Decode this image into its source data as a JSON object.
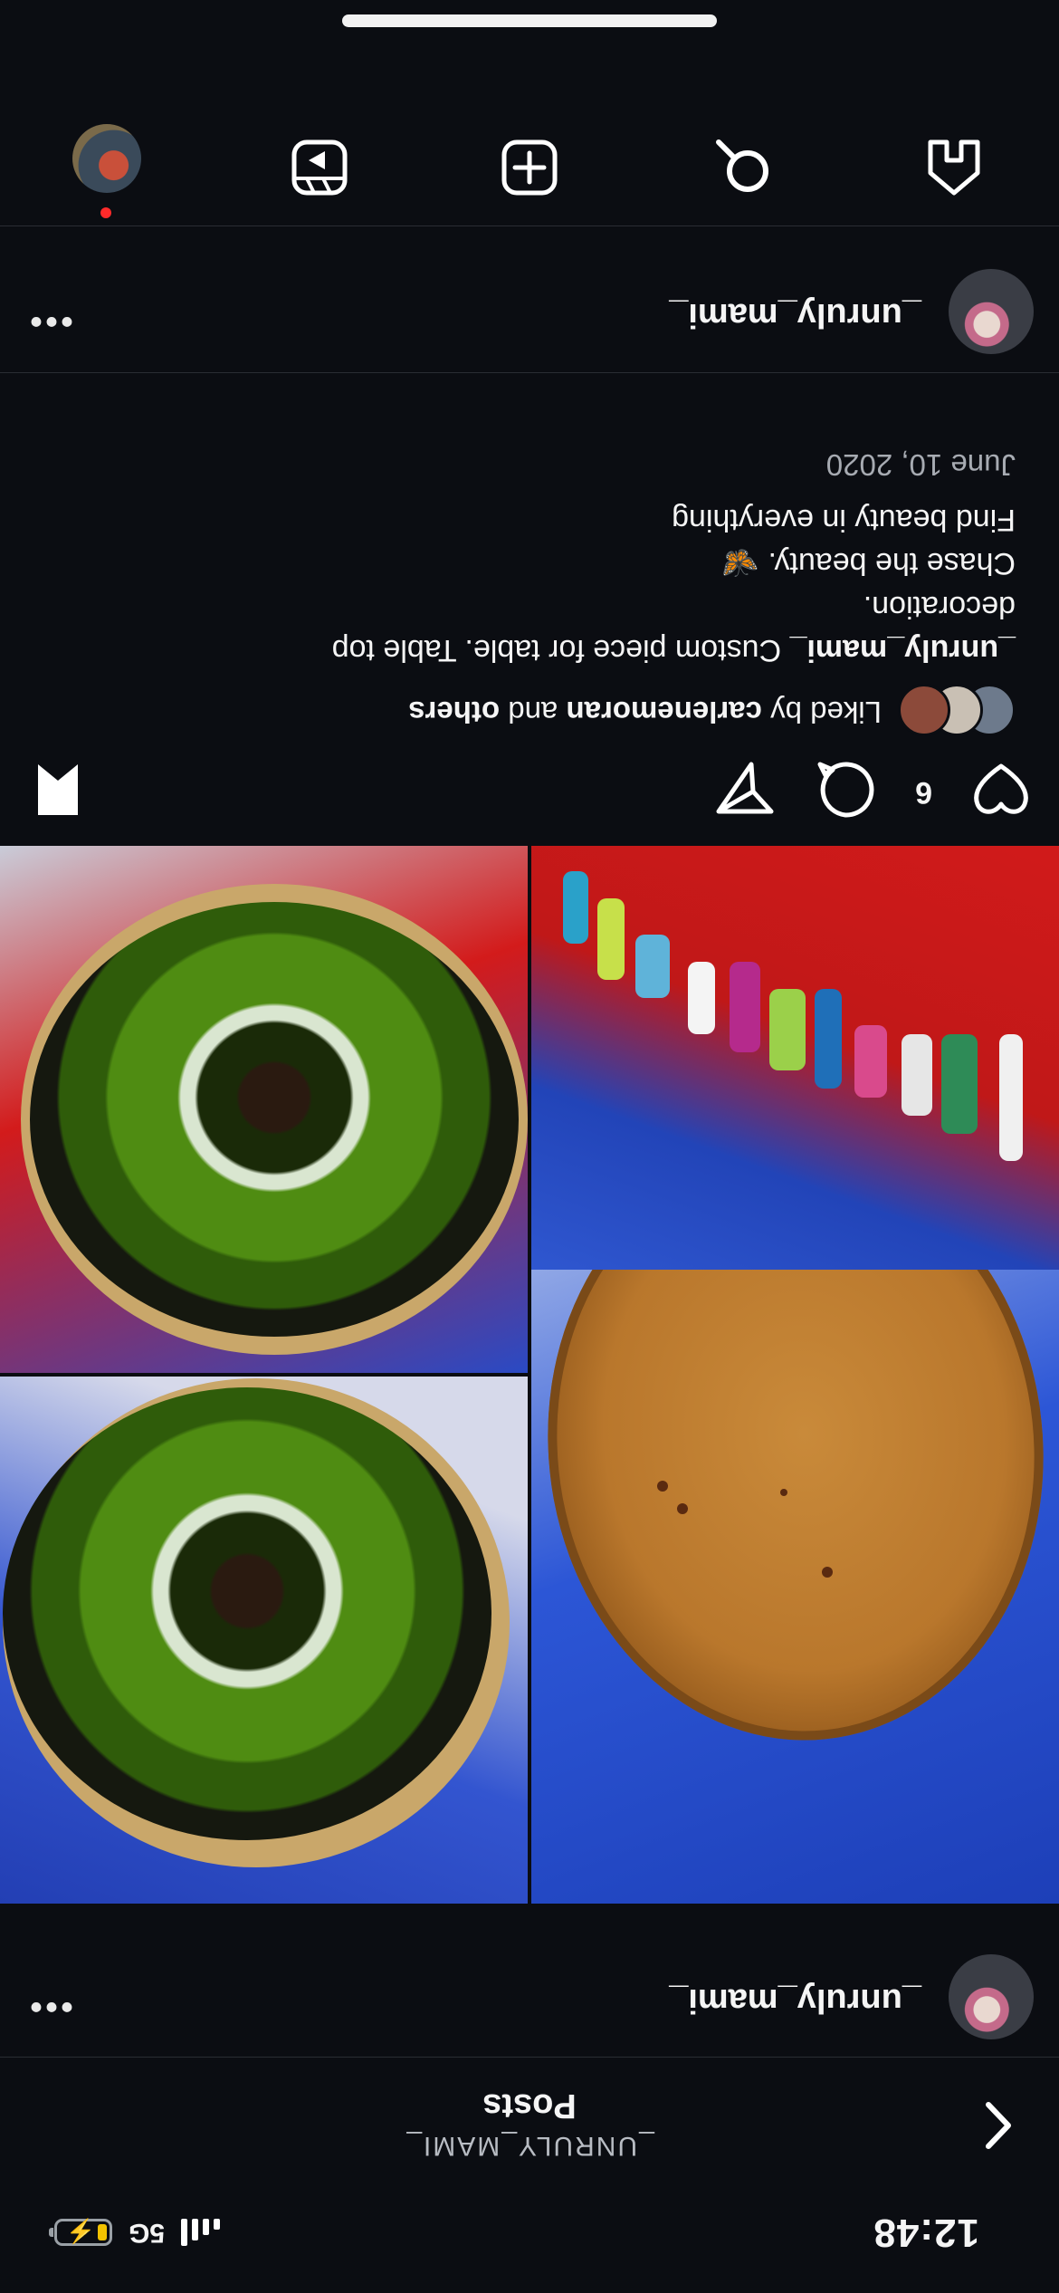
{
  "status": {
    "time": "12:48",
    "network": "5G"
  },
  "header": {
    "subtitle": "_UNRULY_MAMI_",
    "title": "Posts"
  },
  "posts": [
    {
      "username": "_unruly_mami_"
    },
    {
      "username": "_unruly_mami_"
    }
  ],
  "post": {
    "like_count": "6",
    "liked_by": {
      "prefix": "Liked by",
      "user": "carlenemoran",
      "and": "and",
      "others": "others"
    },
    "caption": {
      "username": "_unruly_mami_",
      "line1": "Custom piece for table. Table top",
      "line2": "decoration.",
      "line3": "Chase the beauty.",
      "line3_emoji": "🦋",
      "line4": "Find beauty in everything"
    },
    "date": "June 10, 2020"
  },
  "icons": {
    "back": "chevron-left-icon",
    "more": "more-dots-icon",
    "like": "heart-icon",
    "comment": "comment-icon",
    "share": "send-icon",
    "save": "bookmark-icon",
    "tabs": [
      "home-icon",
      "search-icon",
      "create-post-icon",
      "reels-icon",
      "profile-icon"
    ]
  },
  "colors": {
    "background": "#0b0d12",
    "notification_dot": "#ff2a2a",
    "battery": "#f2c200"
  }
}
